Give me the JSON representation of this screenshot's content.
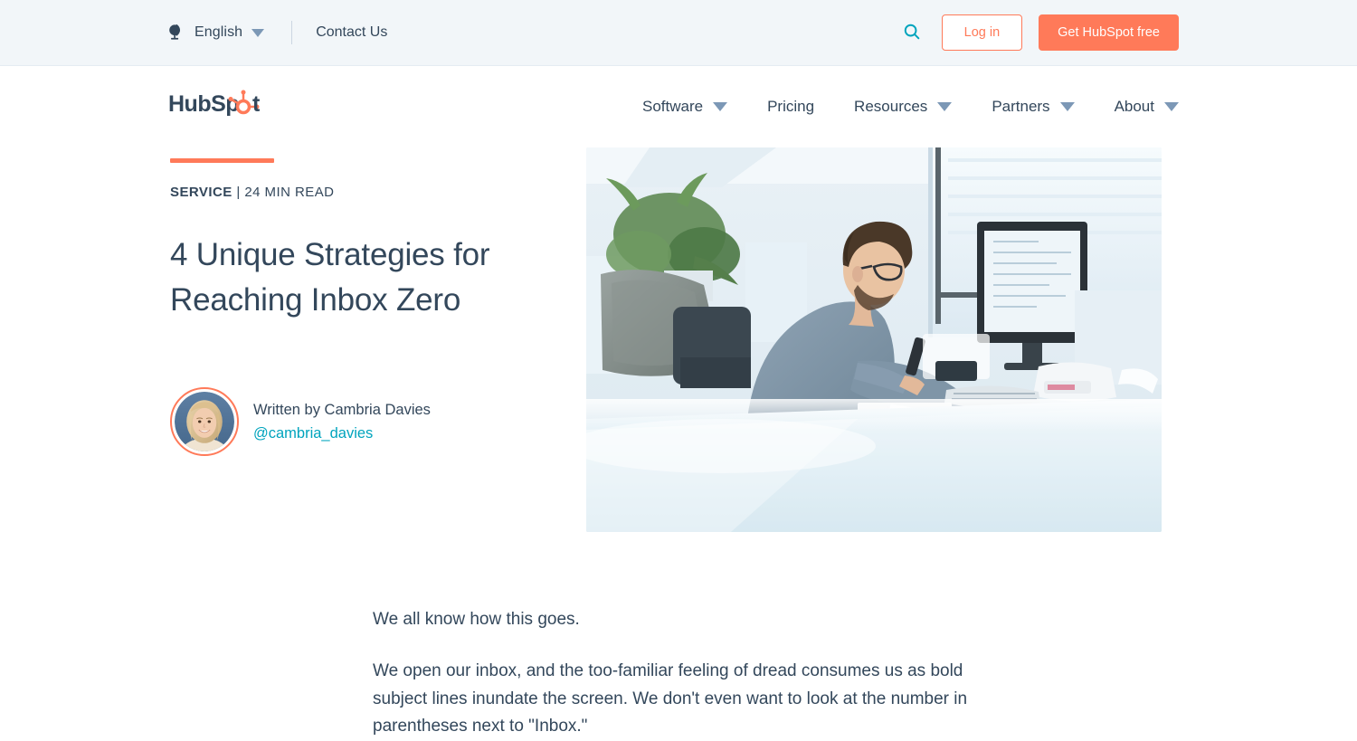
{
  "utility_bar": {
    "globe_icon": "globe-icon",
    "language": "English",
    "language_caret": "chevron-down-icon",
    "contact": "Contact Us",
    "search_icon": "search-icon",
    "login_label": "Log in",
    "cta_label": "Get HubSpot free",
    "background": "#f2f6f9",
    "accent_orange": "#ff7a59",
    "teal": "#00a4bd"
  },
  "nav": {
    "logo_text": "HubSpot",
    "items": [
      {
        "label": "Software",
        "has_caret": true
      },
      {
        "label": "Pricing",
        "has_caret": false
      },
      {
        "label": "Resources",
        "has_caret": true
      },
      {
        "label": "Partners",
        "has_caret": true
      },
      {
        "label": "About",
        "has_caret": true
      }
    ]
  },
  "article": {
    "category": "SERVICE",
    "separator": " | ",
    "read_time": "24 MIN READ",
    "headline": "4 Unique Strategies for Reaching Inbox Zero",
    "author_byline": "Written by Cambria Davies",
    "author_handle": "@cambria_davies",
    "hero_image_alt": "Man working at a desk with a computer monitor in a bright office",
    "body": [
      "We all know how this goes.",
      "We open our inbox, and the too-familiar feeling of dread consumes us as bold subject lines inundate the screen. We don't even want to look at the number in parentheses next to \"Inbox.\""
    ]
  }
}
